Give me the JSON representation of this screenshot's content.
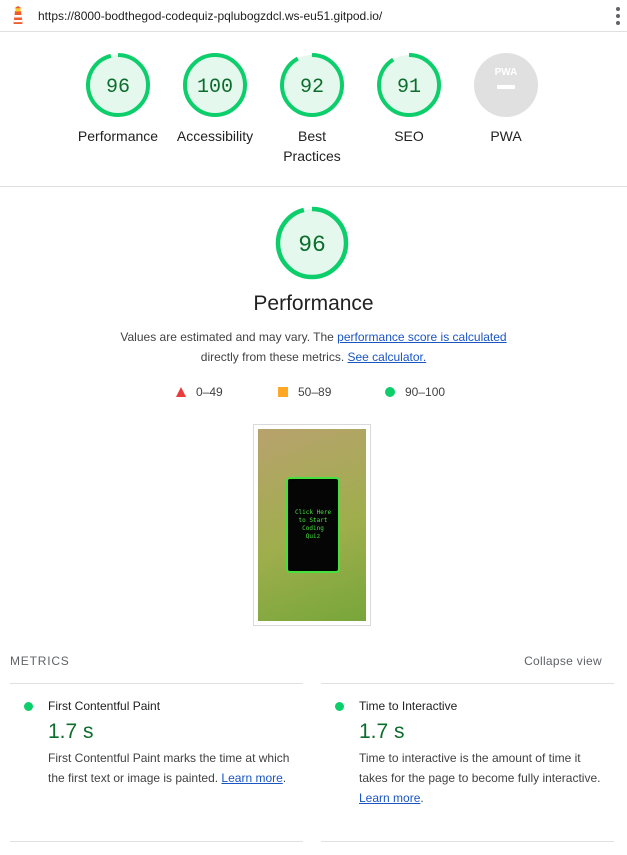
{
  "browser": {
    "url": "https://8000-bodthegod-codequiz-pqlubogzdcl.ws-eu51.gitpod.io/",
    "logo_icon": "lighthouse-icon",
    "menu_icon": "more-vert-icon"
  },
  "summary": {
    "gauges": [
      {
        "score": "96",
        "label": "Performance",
        "status": "pass",
        "fraction": 0.96
      },
      {
        "score": "100",
        "label": "Accessibility",
        "status": "pass",
        "fraction": 1.0
      },
      {
        "score": "92",
        "label_line1": "Best",
        "label_line2": "Practices",
        "status": "pass",
        "fraction": 0.92
      },
      {
        "score": "91",
        "label": "SEO",
        "status": "pass",
        "fraction": 0.91
      },
      {
        "score": "",
        "label": "PWA",
        "badge_text": "PWA",
        "status": "na"
      }
    ]
  },
  "performance": {
    "score": "96",
    "fraction": 0.96,
    "title": "Performance",
    "desc_prefix": "Values are estimated and may vary. The ",
    "desc_link1": "performance score is calculated",
    "desc_mid": "directly from these metrics. ",
    "desc_link2": "See calculator.",
    "legend": [
      {
        "range": "0–49",
        "shape": "triangle",
        "color": "#eb3a3a"
      },
      {
        "range": "50–89",
        "shape": "square",
        "color": "#ffa826"
      },
      {
        "range": "90–100",
        "shape": "circle",
        "color": "#0cce6b"
      }
    ],
    "screenshot_text": "Click Here to Start Coding Quiz"
  },
  "metrics": {
    "heading": "METRICS",
    "toggle_label": "Collapse view",
    "items": [
      {
        "name": "First Contentful Paint",
        "value": "1.7 s",
        "desc": "First Contentful Paint marks the time at which the first text or image is painted. ",
        "link": "Learn more",
        "suffix": "."
      },
      {
        "name": "Time to Interactive",
        "value": "1.7 s",
        "desc": "Time to interactive is the amount of time it takes for the page to become fully interactive. ",
        "link": "Learn more",
        "suffix": "."
      }
    ]
  },
  "colors": {
    "pass": "#0cce6b",
    "pass_text": "#0c6d2c",
    "pass_fill": "#e5f8ee",
    "na_fill": "#e0e0e0",
    "link": "#1a55c4"
  }
}
